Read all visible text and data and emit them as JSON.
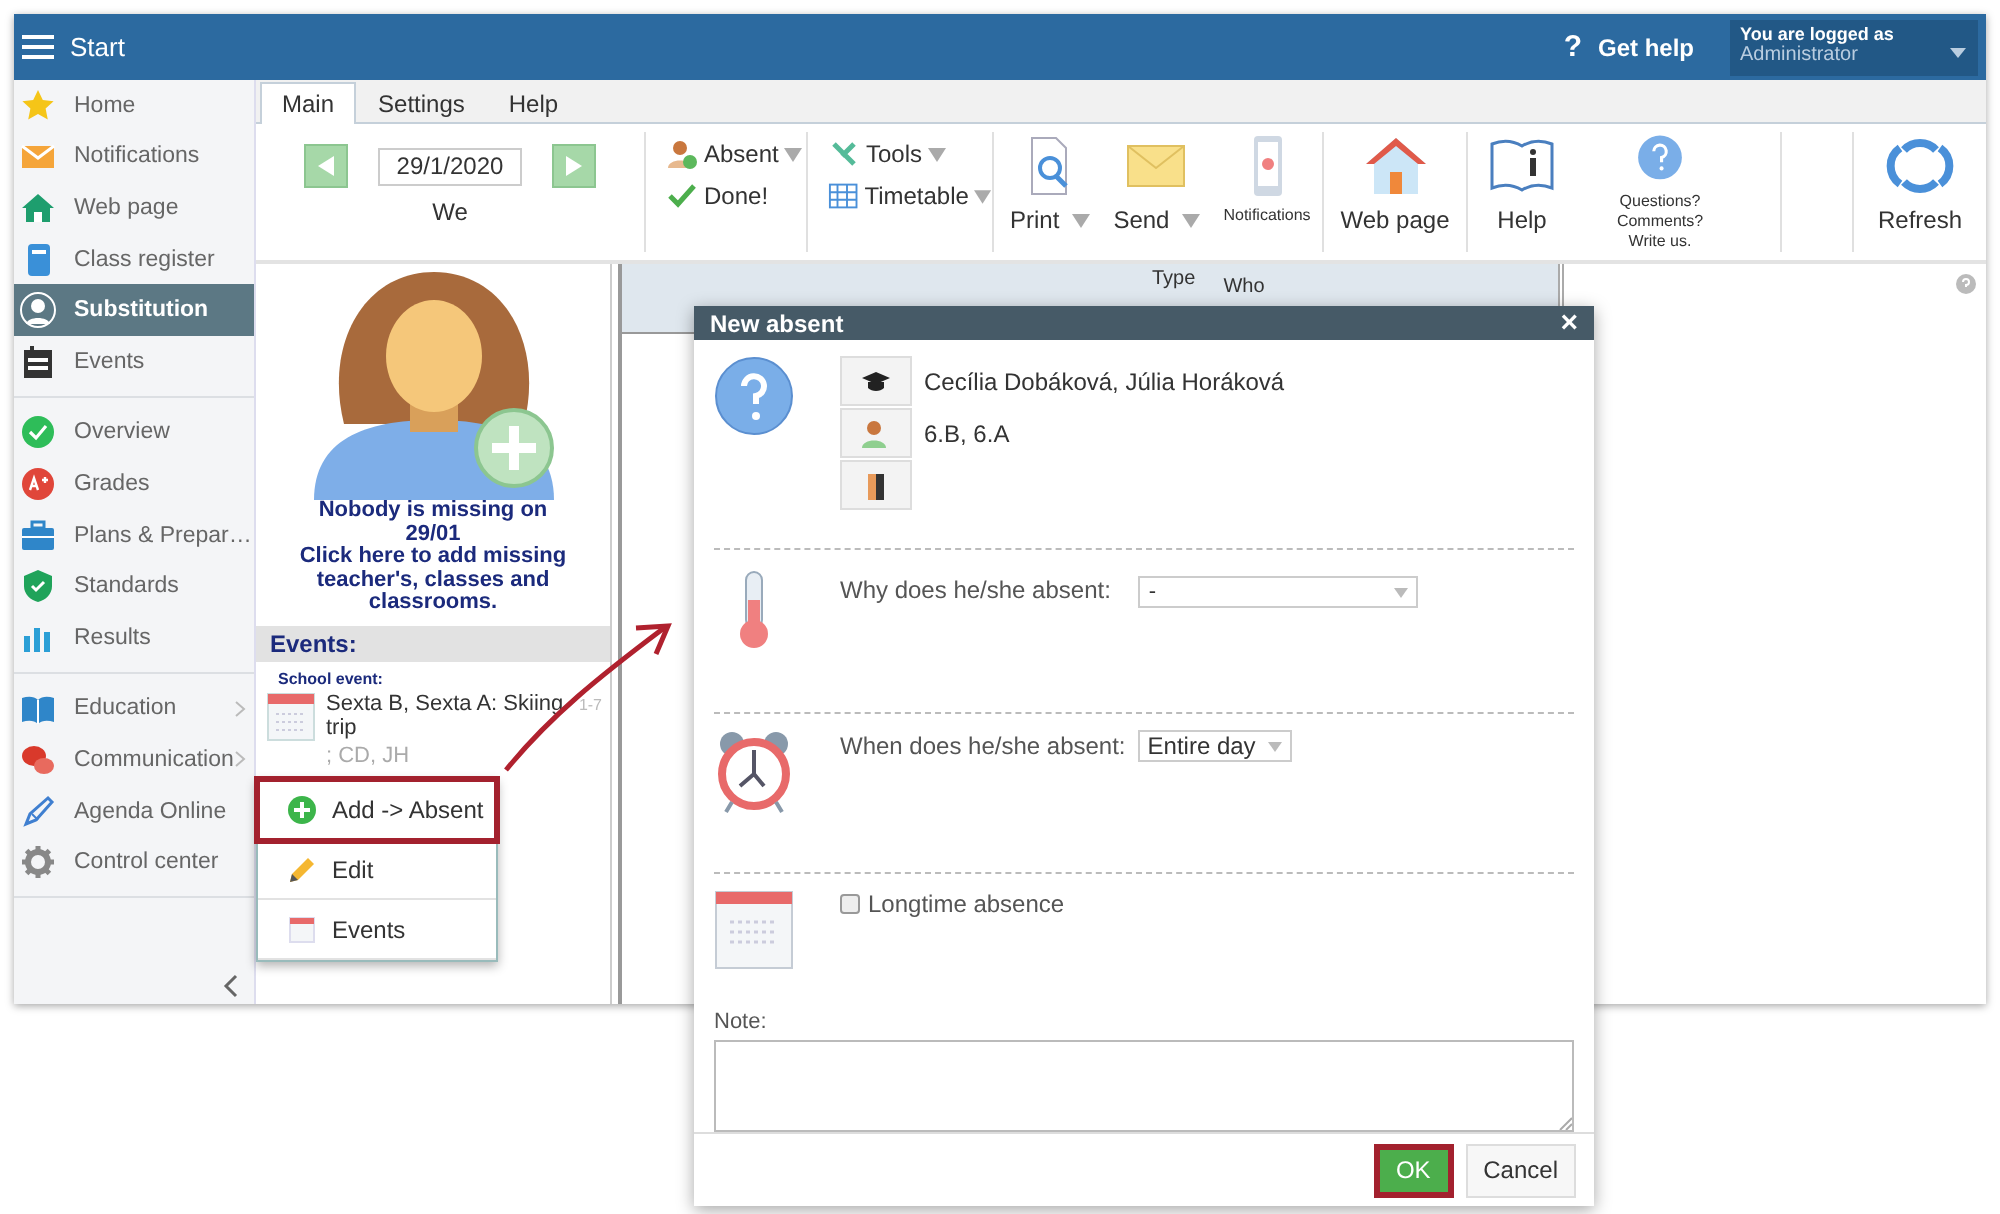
{
  "top_bar": {
    "title": "Start",
    "help_icon": "?",
    "help_label": "Get help",
    "user_caption": "You are logged as",
    "user_name": "Administrator"
  },
  "sidebar": {
    "groups": [
      {
        "items": [
          {
            "label": "Home",
            "selected": false,
            "submenu": false
          },
          {
            "label": "Notifications",
            "selected": false,
            "submenu": false
          },
          {
            "label": "Web page",
            "selected": false,
            "submenu": false
          },
          {
            "label": "Class register",
            "selected": false,
            "submenu": false
          },
          {
            "label": "Substitution",
            "selected": true,
            "submenu": false
          },
          {
            "label": "Events",
            "selected": false,
            "submenu": false
          }
        ]
      },
      {
        "items": [
          {
            "label": "Overview",
            "selected": false,
            "submenu": false
          },
          {
            "label": "Grades",
            "selected": false,
            "submenu": false
          },
          {
            "label": "Plans & Prepar…",
            "selected": false,
            "submenu": false
          },
          {
            "label": "Standards",
            "selected": false,
            "submenu": false
          },
          {
            "label": "Results",
            "selected": false,
            "submenu": false
          }
        ]
      },
      {
        "items": [
          {
            "label": "Education",
            "selected": false,
            "submenu": true
          },
          {
            "label": "Communication",
            "selected": false,
            "submenu": true
          },
          {
            "label": "Agenda Online",
            "selected": false,
            "submenu": false
          },
          {
            "label": "Control center",
            "selected": false,
            "submenu": false
          }
        ]
      }
    ]
  },
  "tabs": [
    {
      "label": "Main",
      "selected": true
    },
    {
      "label": "Settings",
      "selected": false
    },
    {
      "label": "Help",
      "selected": false
    }
  ],
  "toolbar": {
    "date": "29/1/2020",
    "weekday": "We",
    "absent": {
      "label": "Absent",
      "dropdown": true
    },
    "done": {
      "label": "Done!",
      "dropdown": false
    },
    "tools": {
      "label": "Tools",
      "dropdown": true
    },
    "timetable": {
      "label": "Timetable",
      "dropdown": true
    },
    "print": {
      "label": "Print",
      "dropdown": true
    },
    "send": {
      "label": "Send",
      "dropdown": true
    },
    "notifications": {
      "label": "Notifications",
      "dropdown": false
    },
    "web_page": {
      "label": "Web page",
      "dropdown": false
    },
    "help": {
      "label": "Help",
      "dropdown": false
    },
    "feedback": {
      "label": "Questions? Comments? Write us.",
      "dropdown": false
    },
    "refresh": {
      "label": "Refresh",
      "dropdown": false
    }
  },
  "left_panel": {
    "empty_message": "Nobody is missing on 29/01",
    "add_hint": "Click here to add missing teacher's, classes and classrooms.",
    "events_heading": "Events:",
    "event_type": "School event:",
    "events": [
      {
        "title": "Sexta B, Sexta A: Skiing trip",
        "time": "1-7",
        "people": "; CD, JH"
      }
    ]
  },
  "context_menu": {
    "items": [
      {
        "label": "Add -> Absent",
        "highlighted": true
      },
      {
        "label": "Edit",
        "highlighted": false
      },
      {
        "label": "Events",
        "highlighted": false
      }
    ]
  },
  "table": {
    "columns": [
      "Type",
      "Who"
    ]
  },
  "dialog": {
    "title": "New absent",
    "close": "×",
    "teachers": "Cecília Dobáková, Júlia Horáková",
    "classes": "6.B, 6.A",
    "reason": {
      "label": "Why does he/she absent:",
      "value": "-"
    },
    "when": {
      "label": "When does he/she absent:",
      "value": "Entire day"
    },
    "longtime": {
      "label": "Longtime absence",
      "checked": false
    },
    "note": {
      "label": "Note:"
    },
    "buttons": [
      {
        "label": "OK",
        "kind": "primary",
        "highlighted": true
      },
      {
        "label": "Cancel",
        "kind": "secondary",
        "highlighted": false
      }
    ]
  }
}
